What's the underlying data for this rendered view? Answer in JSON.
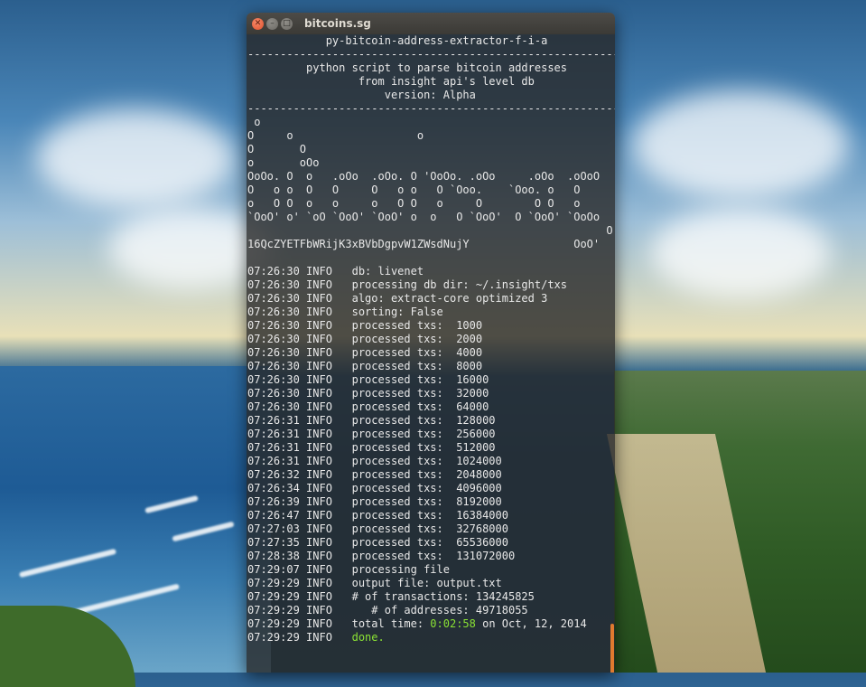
{
  "window": {
    "title": "bitcoins.sg"
  },
  "terminal": {
    "lines": [
      "            py-bitcoin-address-extractor-f-i-a",
      "-----------------------------------------------------------",
      "         python script to parse bitcoin addresses",
      "                 from insight api's level db",
      "                     version: Alpha",
      "-----------------------------------------------------------",
      " o",
      "O     o                   o",
      "O       O",
      "o       oOo",
      "OoOo. O  o   .oOo  .oOo. O 'OoOo. .oOo     .oOo  .oOoO",
      "O   o o  O   O     O   o o   O `Ooo.    `Ooo. o   O",
      "o   O O  o   o     o   O O   o     O        O O   o",
      "`OoO' o' `oO `OoO' `OoO' o  o   O `OoO'  O `OoO' `OoOo",
      "                                                       O",
      "16QcZYETFbWRijK3xBVbDgpvW1ZWsdNujY                OoO'",
      "",
      "07:26:30 INFO   db: livenet",
      "07:26:30 INFO   processing db dir: ~/.insight/txs",
      "07:26:30 INFO   algo: extract-core optimized 3",
      "07:26:30 INFO   sorting: False",
      "07:26:30 INFO   processed txs:  1000",
      "07:26:30 INFO   processed txs:  2000",
      "07:26:30 INFO   processed txs:  4000",
      "07:26:30 INFO   processed txs:  8000",
      "07:26:30 INFO   processed txs:  16000",
      "07:26:30 INFO   processed txs:  32000",
      "07:26:30 INFO   processed txs:  64000",
      "07:26:31 INFO   processed txs:  128000",
      "07:26:31 INFO   processed txs:  256000",
      "07:26:31 INFO   processed txs:  512000",
      "07:26:31 INFO   processed txs:  1024000",
      "07:26:32 INFO   processed txs:  2048000",
      "07:26:34 INFO   processed txs:  4096000",
      "07:26:39 INFO   processed txs:  8192000",
      "07:26:47 INFO   processed txs:  16384000",
      "07:27:03 INFO   processed txs:  32768000",
      "07:27:35 INFO   processed txs:  65536000",
      "07:28:38 INFO   processed txs:  131072000",
      "07:29:07 INFO   processing file",
      "07:29:29 INFO   output file: output.txt",
      "07:29:29 INFO   # of transactions: 134245825",
      "07:29:29 INFO      # of addresses: 49718055"
    ],
    "total_time": {
      "prefix": "07:29:29 INFO   total time: ",
      "value": "0:02:58",
      "suffix": " on Oct, 12, 2014"
    },
    "done": {
      "prefix": "07:29:29 INFO   ",
      "value": "done."
    },
    "accent_color": "#8ae234",
    "scroll_color": "#e07a2f"
  }
}
